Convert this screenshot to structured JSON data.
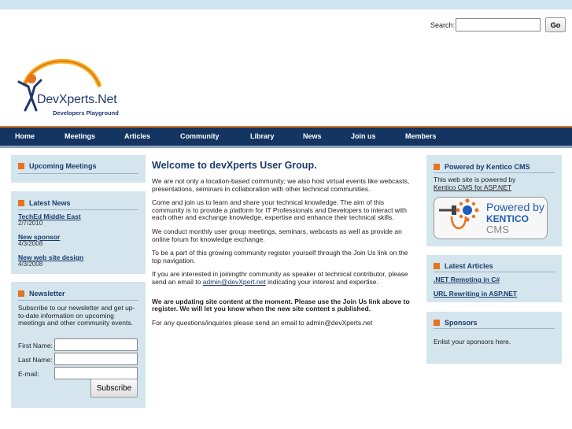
{
  "search": {
    "label": "Search:",
    "value": "",
    "button": "Go"
  },
  "logo": {
    "title": "DevXperts.Net",
    "subtitle": "Developers Playground"
  },
  "nav": [
    "Home",
    "Meetings",
    "Articles",
    "Community",
    "Library",
    "News",
    "Join us",
    "Members"
  ],
  "left": {
    "upcoming": {
      "title": "Upcoming Meetings"
    },
    "news": {
      "title": "Latest News",
      "items": [
        {
          "title": "TechEd Middle East",
          "date": "2/7/2010"
        },
        {
          "title": "New sponsor",
          "date": "4/3/2008"
        },
        {
          "title": "New web site design",
          "date": "4/3/2008"
        }
      ]
    },
    "newsletter": {
      "title": "Newsletter",
      "text": "Subscribe to our newsletter and get up-to-date information on upcoming meetings and other community events.",
      "fields": [
        {
          "label": "First Name:",
          "value": ""
        },
        {
          "label": "Last Name:",
          "value": ""
        },
        {
          "label": "E-mail:",
          "value": ""
        }
      ],
      "button": "Subscribe"
    }
  },
  "main": {
    "title": "Welcome to devXperts User Group.",
    "p1": "We are not only a location-based community; we also host virtual events like webcasts, presentations, seminars in collaboration with other technical communities.",
    "p2": "Come and join us to learn and share your technical knowledge. The aim of this community is to provide a platform for IT Professionals and Developers to interact with each other and exchange knowledge, expertise and enhance their technical skills.",
    "p3": "We conduct monthly user group meetings, seminars, webcasts as well as provide an online forum for knowledge exchange.",
    "p4": "To be a part of this growing community register yourself through the Join Us link on the top navigation.",
    "p5_pre": "If  you are interested in joiningthr community as speaker ot technical contributor, please send an email to ",
    "p5_link": "admin@devXpert.net",
    "p5_post": " indicating your interest and expertise.",
    "notice": "We are updating site content at the moment. Please use the Join Us link above to register. We will let you know when the new site content s published.",
    "p6": "For any questions/inquiries please send an email to admin@devXperts.net"
  },
  "right": {
    "kentico": {
      "title": "Powered by Kentico CMS",
      "text": "This web site is powered by",
      "link": "Kentico CMS for ASP.NET",
      "badge_powered": "Powered by",
      "badge_brand": "KENTICO",
      "badge_cms": "CMS"
    },
    "articles": {
      "title": "Latest Articles",
      "items": [
        ".NET Remoting in C#",
        "URL Rewriting in ASP.NET"
      ]
    },
    "sponsors": {
      "title": "Sponsors",
      "text": "Enlist your sponsors here."
    }
  },
  "colors": {
    "nav_bg": "#143562",
    "accent": "#e8731f",
    "box_bg": "#d4e5ee",
    "heading": "#1b3c6b"
  }
}
